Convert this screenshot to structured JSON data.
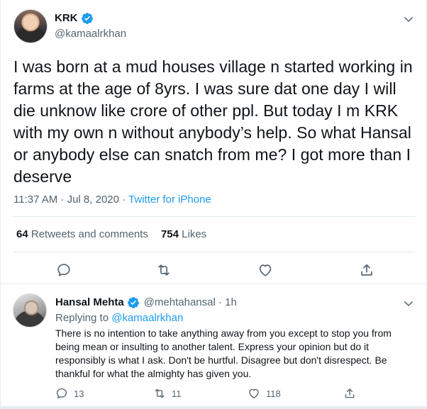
{
  "main_tweet": {
    "display_name": "KRK",
    "handle": "@kamaalrkhan",
    "text": "I was born at a mud houses village n started working in farms at the age of 8yrs. I was sure dat one day I will die unknow like crore of other ppl. But today I m KRK with my own n without anybody’s help. So what Hansal or anybody else can snatch from me? I got more than I deserve",
    "time": "11:37 AM · Jul 8, 2020 · ",
    "source": "Twitter for iPhone",
    "stats": {
      "retweets_count": "64",
      "retweets_label": "Retweets and comments",
      "likes_count": "754",
      "likes_label": "Likes"
    }
  },
  "reply": {
    "display_name": "Hansal Mehta",
    "handle": "@mehtahansal · 1h",
    "replying_prefix": "Replying to ",
    "replying_to": "@kamaalrkhan",
    "text": "There is no intention to take anything away from you except to stop you from being mean or insulting to another talent. Express your opinion but do it responsibly is what I ask. Don't be hurtful. Disagree but don't disrespect. Be thankful for what the almighty has given you.",
    "counts": {
      "replies": "13",
      "retweets": "11",
      "likes": "118"
    }
  },
  "icons": [
    "verified-badge",
    "chevron-down-icon",
    "reply-icon",
    "retweet-icon",
    "like-icon",
    "share-icon"
  ],
  "colors": {
    "accent": "#1d9bf0",
    "text": "#0f1419",
    "secondary": "#536471",
    "divider": "#e6ecf0"
  }
}
